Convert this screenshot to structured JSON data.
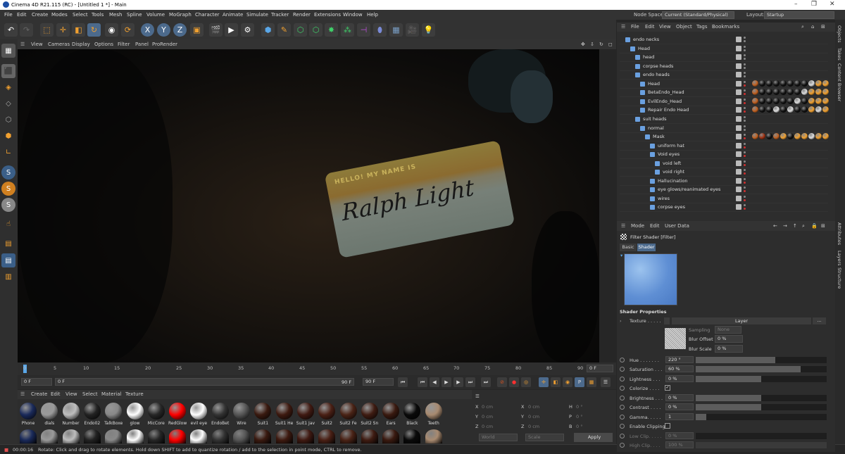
{
  "window": {
    "title": "Cinema 4D R21.115 (RC) - [Untitled 1 *] - Main"
  },
  "menubar": {
    "items": [
      "File",
      "Edit",
      "Create",
      "Modes",
      "Select",
      "Tools",
      "Mesh",
      "Spline",
      "Volume",
      "MoGraph",
      "Character",
      "Animate",
      "Simulate",
      "Tracker",
      "Render",
      "Extensions",
      "Window",
      "Help"
    ],
    "node_space_label": "Node Space:",
    "node_space_value": "Current (Standard/Physical)",
    "layout_label": "Layout:",
    "layout_value": "Startup"
  },
  "toolbar": {
    "axis_x": "X",
    "axis_y": "Y",
    "axis_z": "Z"
  },
  "viewport": {
    "menu": [
      "View",
      "Cameras",
      "Display",
      "Options",
      "Filter",
      "Panel",
      "ProRender"
    ],
    "nametag_header": "HELLO! MY NAME IS",
    "nametag_name": "Ralph Light"
  },
  "timeline": {
    "ticks": [
      "0",
      "5",
      "10",
      "15",
      "20",
      "25",
      "30",
      "35",
      "40",
      "45",
      "50",
      "55",
      "60",
      "65",
      "70",
      "75",
      "80",
      "85",
      "90"
    ],
    "current_frame": "0 F",
    "start_frame": "0 F",
    "range_start": "0 F",
    "range_end": "90 F",
    "end_frame": "90 F"
  },
  "material_manager": {
    "menu": [
      "Create",
      "Edit",
      "View",
      "Select",
      "Material",
      "Texture"
    ],
    "materials": [
      {
        "name": "Phone",
        "color": "#1a2a5a"
      },
      {
        "name": "dials",
        "color": "#9a9a9a"
      },
      {
        "name": "Number",
        "color": "#bdbdbd"
      },
      {
        "name": "Endo02",
        "color": "#222222"
      },
      {
        "name": "TalkBoxe",
        "color": "#888888"
      },
      {
        "name": "glow",
        "color": "#ffffff"
      },
      {
        "name": "MicCore",
        "color": "#262626"
      },
      {
        "name": "RedGlow",
        "color": "#ff0000"
      },
      {
        "name": "evil eye",
        "color": "#ffffff"
      },
      {
        "name": "EndoBet",
        "color": "#333333"
      },
      {
        "name": "Wire",
        "color": "#555555"
      },
      {
        "name": "Suit1",
        "color": "#3a1a10"
      },
      {
        "name": "Suit1 He",
        "color": "#3e1a10"
      },
      {
        "name": "Suit1 Jav",
        "color": "#401a12"
      },
      {
        "name": "Suit2",
        "color": "#4a2015"
      },
      {
        "name": "Suit2 Fe",
        "color": "#4a2316"
      },
      {
        "name": "Suit2 Sn",
        "color": "#3f1c12"
      },
      {
        "name": "Ears",
        "color": "#3a1a10"
      },
      {
        "name": "Black",
        "color": "#0a0a0a"
      },
      {
        "name": "Teeth",
        "color": "#a88a70"
      }
    ]
  },
  "coords": {
    "x_label": "X",
    "y_label": "Y",
    "z_label": "Z",
    "pos_x": "0 cm",
    "pos_y": "0 cm",
    "pos_z": "0 cm",
    "size_x_label": "X",
    "size_y_label": "Y",
    "size_z_label": "Z",
    "size_x": "0 cm",
    "size_y": "0 cm",
    "size_z": "0 cm",
    "h_label": "H",
    "p_label": "P",
    "b_label": "B",
    "h": "0 °",
    "p": "0 °",
    "b": "0 °",
    "mode_world": "World",
    "mode_scale": "Scale",
    "apply": "Apply"
  },
  "object_manager": {
    "menu": [
      "File",
      "Edit",
      "View",
      "Object",
      "Tags",
      "Bookmarks"
    ],
    "objects": [
      {
        "name": "endo necks",
        "indent": 0
      },
      {
        "name": "Head",
        "indent": 1
      },
      {
        "name": "head",
        "indent": 2
      },
      {
        "name": "corpse heads",
        "indent": 2
      },
      {
        "name": "endo heads",
        "indent": 2
      },
      {
        "name": "Head",
        "indent": 3,
        "tags": "a"
      },
      {
        "name": "BetaEndo_Head",
        "indent": 3,
        "tags": "b"
      },
      {
        "name": "EvilEndo_Head",
        "indent": 3,
        "tags": "c"
      },
      {
        "name": "Repair Endo Head",
        "indent": 3,
        "tags": "d"
      },
      {
        "name": "suit heads",
        "indent": 2
      },
      {
        "name": "normal",
        "indent": 3
      },
      {
        "name": "Mask",
        "indent": 4,
        "tags": "e"
      },
      {
        "name": "uniform hat",
        "indent": 5
      },
      {
        "name": "Void eyes",
        "indent": 5
      },
      {
        "name": "void left",
        "indent": 6
      },
      {
        "name": "void right",
        "indent": 6
      },
      {
        "name": "Hallucination",
        "indent": 5
      },
      {
        "name": "eye glows/reanimated eyes",
        "indent": 5
      },
      {
        "name": "wires",
        "indent": 5
      },
      {
        "name": "corpse eyes",
        "indent": 5
      }
    ]
  },
  "attributes": {
    "menu": [
      "Mode",
      "Edit",
      "User Data"
    ],
    "object_title": "Filter Shader [Filter]",
    "tab_basic": "Basic",
    "tab_shader": "Shader",
    "section": "Shader Properties",
    "texture_label": "Texture . . . . .",
    "layer_label": "Layer",
    "more_button": "...",
    "sampling_label": "Sampling",
    "sampling_value": "None",
    "blur_offset_label": "Blur Offset",
    "blur_offset_value": "0 %",
    "blur_scale_label": "Blur Scale",
    "blur_scale_value": "0 %",
    "params": [
      {
        "label": "Hue . . . . . . .",
        "value": "220 °",
        "fraction": 0.61
      },
      {
        "label": "Saturation . . .",
        "value": "60 %",
        "fraction": 0.8
      },
      {
        "label": "Lightness . . .",
        "value": "0 %",
        "fraction": 0.5
      },
      {
        "label": "Colorize . . . .",
        "value": "",
        "checkbox": true
      },
      {
        "label": "Brightness . . .",
        "value": "0 %",
        "fraction": 0.5
      },
      {
        "label": "Contrast . . . .",
        "value": "0 %",
        "fraction": 0.5
      },
      {
        "label": "Gamma. . . . .",
        "value": "1",
        "fraction": 0.08
      },
      {
        "label": "Enable Clipping",
        "value": "",
        "checkbox": true
      },
      {
        "label": "Low Clip. . . . .",
        "value": "0 %",
        "fraction": 0
      },
      {
        "label": "High Clip. . . .",
        "value": "100 %",
        "fraction": 1
      }
    ]
  },
  "right_tabs": [
    "Objects",
    "Takes",
    "Content Browser",
    "Attributes",
    "Layers",
    "Structure"
  ],
  "statusbar": {
    "time": "00:00:16",
    "message": "Rotate: Click and drag to rotate elements. Hold down SHIFT to add to quantize rotation / add to the selection in point mode, CTRL to remove."
  }
}
